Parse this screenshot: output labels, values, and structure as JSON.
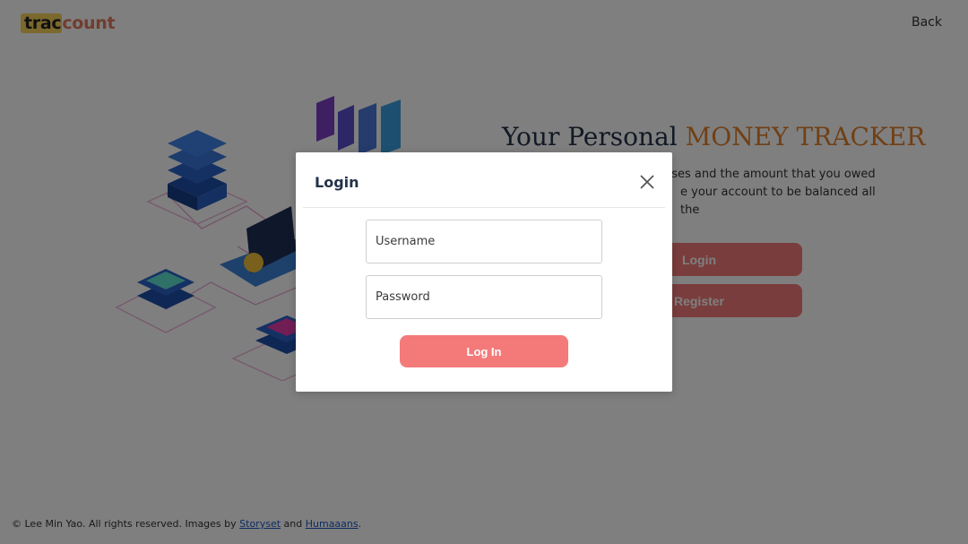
{
  "header": {
    "logo_part1": "trac",
    "logo_part2": "count",
    "back_label": "Back"
  },
  "hero": {
    "title_plain": "Your Personal ",
    "title_accent": "MONEY TRACKER",
    "description_line1": "enses and the amount that you owed",
    "description_line2": "e your account to be balanced all the",
    "login_label": "Login",
    "register_label": "Register"
  },
  "footer": {
    "prefix": "© Lee Min Yao. All rights reserved. Images by ",
    "link1": "Storyset",
    "middle": " and ",
    "link2": "Humaaans",
    "suffix": "."
  },
  "modal": {
    "title": "Login",
    "close_icon": "close-icon",
    "username_placeholder": "Username",
    "password_placeholder": "Password",
    "submit_label": "Log In"
  },
  "colors": {
    "accent": "#f47a7a",
    "title_accent": "#e0812d",
    "navy": "#24324a"
  }
}
